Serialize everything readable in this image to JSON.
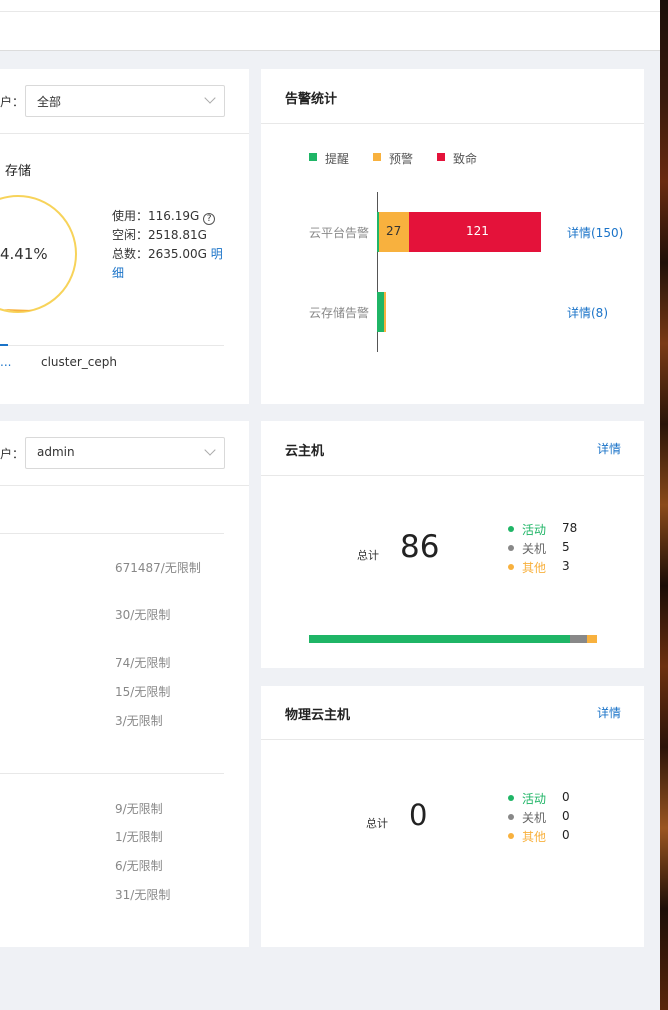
{
  "storage_card": {
    "tenant_label": "户：",
    "tenant_value": "全部",
    "section_title": "存储",
    "percent": "4.41%",
    "used_label": "使用：",
    "used_value": "116.19G",
    "free_label": "空闲：",
    "free_value": "2518.81G",
    "total_label": "总数：",
    "total_value": "2635.00G",
    "detail_part1": "明",
    "detail_part2": "细",
    "cluster_truncated": "...",
    "cluster_name": "cluster_ceph"
  },
  "alarm_card": {
    "title": "告警统计",
    "legend": [
      {
        "label": "提醒",
        "color": "#1fb566"
      },
      {
        "label": "预警",
        "color": "#f8b13e"
      },
      {
        "label": "致命",
        "color": "#e4123a"
      }
    ],
    "rows": [
      {
        "label": "云平台告警",
        "link": "详情(150)"
      },
      {
        "label": "云存储告警",
        "link": "详情(8)"
      }
    ],
    "chart_data": {
      "type": "bar",
      "orientation": "horizontal",
      "stacked": true,
      "categories": [
        "云平台告警",
        "云存储告警"
      ],
      "series": [
        {
          "name": "提醒",
          "values": [
            2,
            6
          ],
          "color": "#1fb566"
        },
        {
          "name": "预警",
          "values": [
            27,
            2
          ],
          "color": "#f8b13e"
        },
        {
          "name": "致命",
          "values": [
            121,
            0
          ],
          "color": "#e4123a"
        }
      ],
      "data_labels": [
        [
          "",
          "27",
          "121"
        ],
        [
          "",
          "",
          ""
        ]
      ],
      "legend_position": "top-left"
    }
  },
  "quota_card": {
    "tenant_label": "户：",
    "tenant_value": "admin",
    "group1": [
      "671487/无限制",
      "30/无限制",
      "74/无限制",
      "15/无限制",
      "3/无限制"
    ],
    "group2": [
      "9/无限制",
      "1/无限制",
      "6/无限制",
      "31/无限制"
    ]
  },
  "vm_card": {
    "title": "云主机",
    "detail": "详情",
    "total_label": "总计",
    "total": "86",
    "stats": [
      {
        "label": "活动",
        "value": "78",
        "color": "#1fb566",
        "label_color": "#1fb566"
      },
      {
        "label": "关机",
        "value": "5",
        "color": "#888888",
        "label_color": "#666666"
      },
      {
        "label": "其他",
        "value": "3",
        "color": "#f8b13e",
        "label_color": "#f8b13e"
      }
    ],
    "bar_fractions": [
      0.907,
      0.058,
      0.035
    ]
  },
  "pm_card": {
    "title": "物理云主机",
    "detail": "详情",
    "total_label": "总计",
    "total": "0",
    "stats": [
      {
        "label": "活动",
        "value": "0",
        "color": "#1fb566",
        "label_color": "#1fb566"
      },
      {
        "label": "关机",
        "value": "0",
        "color": "#888888",
        "label_color": "#666666"
      },
      {
        "label": "其他",
        "value": "0",
        "color": "#f8b13e",
        "label_color": "#f8b13e"
      }
    ]
  },
  "icons": {
    "help": "question-circle-icon",
    "dropdown": "chevron-down-icon"
  }
}
